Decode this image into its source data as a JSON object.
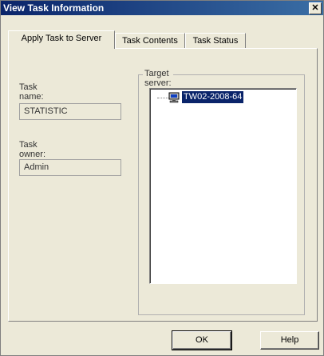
{
  "window": {
    "title": "View Task Information",
    "close_glyph": "✕"
  },
  "tabs": [
    {
      "label": "Apply Task to Server",
      "active": true
    },
    {
      "label": "Task Contents",
      "active": false
    },
    {
      "label": "Task Status",
      "active": false
    }
  ],
  "task": {
    "name_label": "Task name:",
    "name_value": "STATISTIC",
    "owner_label": "Task owner:",
    "owner_value": "Admin"
  },
  "target": {
    "group_label": "Target server:",
    "servers": [
      {
        "name": "TW02-2008-64",
        "icon": "computer-icon",
        "selected": true
      }
    ]
  },
  "buttons": {
    "ok": "OK",
    "help": "Help"
  },
  "colors": {
    "titlebar": "#0a246a",
    "dialog_bg": "#ece9d8",
    "selection": "#0a246a"
  }
}
